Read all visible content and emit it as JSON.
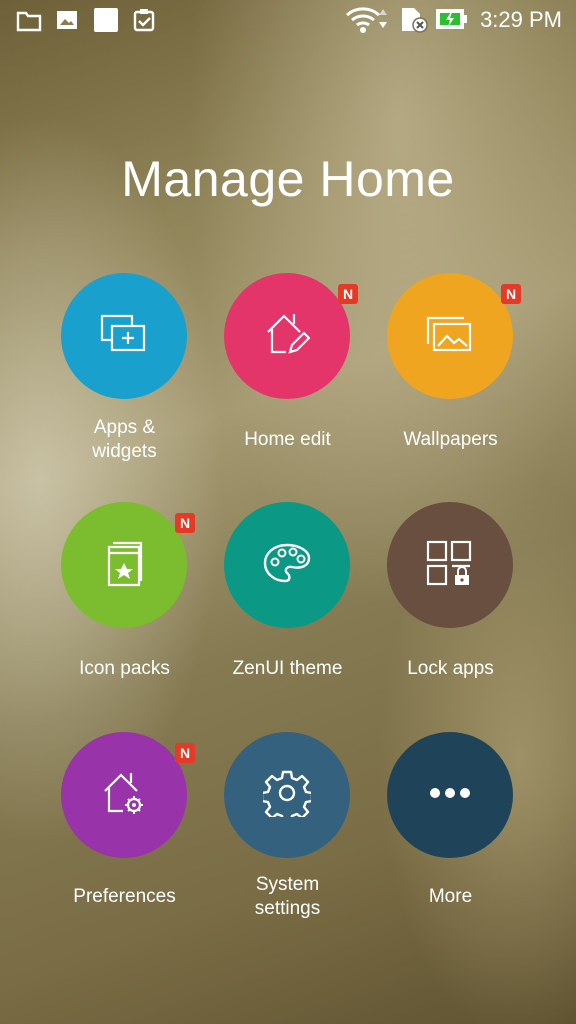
{
  "status_bar": {
    "left_icons": [
      "folder-icon",
      "gallery-icon",
      "blank-square-icon",
      "clipboard-check-icon"
    ],
    "right_icons": [
      "wifi-icon",
      "sim-card-off-icon",
      "battery-charging-icon"
    ],
    "time": "3:29 PM"
  },
  "page": {
    "title": "Manage Home"
  },
  "tiles": [
    {
      "label": "Apps & widgets",
      "lines": [
        "Apps &",
        "widgets"
      ],
      "icon": "apps-widgets-icon",
      "color": "#1aa0cc",
      "new_badge": false
    },
    {
      "label": "Home edit",
      "lines": [
        "Home edit"
      ],
      "icon": "home-edit-icon",
      "color": "#e3356a",
      "new_badge": true,
      "badge": "N"
    },
    {
      "label": "Wallpapers",
      "lines": [
        "Wallpapers"
      ],
      "icon": "wallpaper-icon",
      "color": "#efa520",
      "new_badge": true,
      "badge": "N"
    },
    {
      "label": "Icon packs",
      "lines": [
        "Icon packs"
      ],
      "icon": "icon-pack-icon",
      "color": "#7bbd2e",
      "new_badge": true,
      "badge": "N"
    },
    {
      "label": "ZenUI theme",
      "lines": [
        "ZenUI theme"
      ],
      "icon": "palette-icon",
      "color": "#0b9985",
      "new_badge": false
    },
    {
      "label": "Lock apps",
      "lines": [
        "Lock apps"
      ],
      "icon": "lock-apps-icon",
      "color": "#684f3f",
      "new_badge": false
    },
    {
      "label": "Preferences",
      "lines": [
        "Preferences"
      ],
      "icon": "home-settings-icon",
      "color": "#9833aa",
      "new_badge": true,
      "badge": "N"
    },
    {
      "label": "System settings",
      "lines": [
        "System",
        "settings"
      ],
      "icon": "gear-icon",
      "color": "#33617e",
      "new_badge": false
    },
    {
      "label": "More",
      "lines": [
        "More"
      ],
      "icon": "more-dots-icon",
      "color": "#1f445a",
      "new_badge": false
    }
  ]
}
